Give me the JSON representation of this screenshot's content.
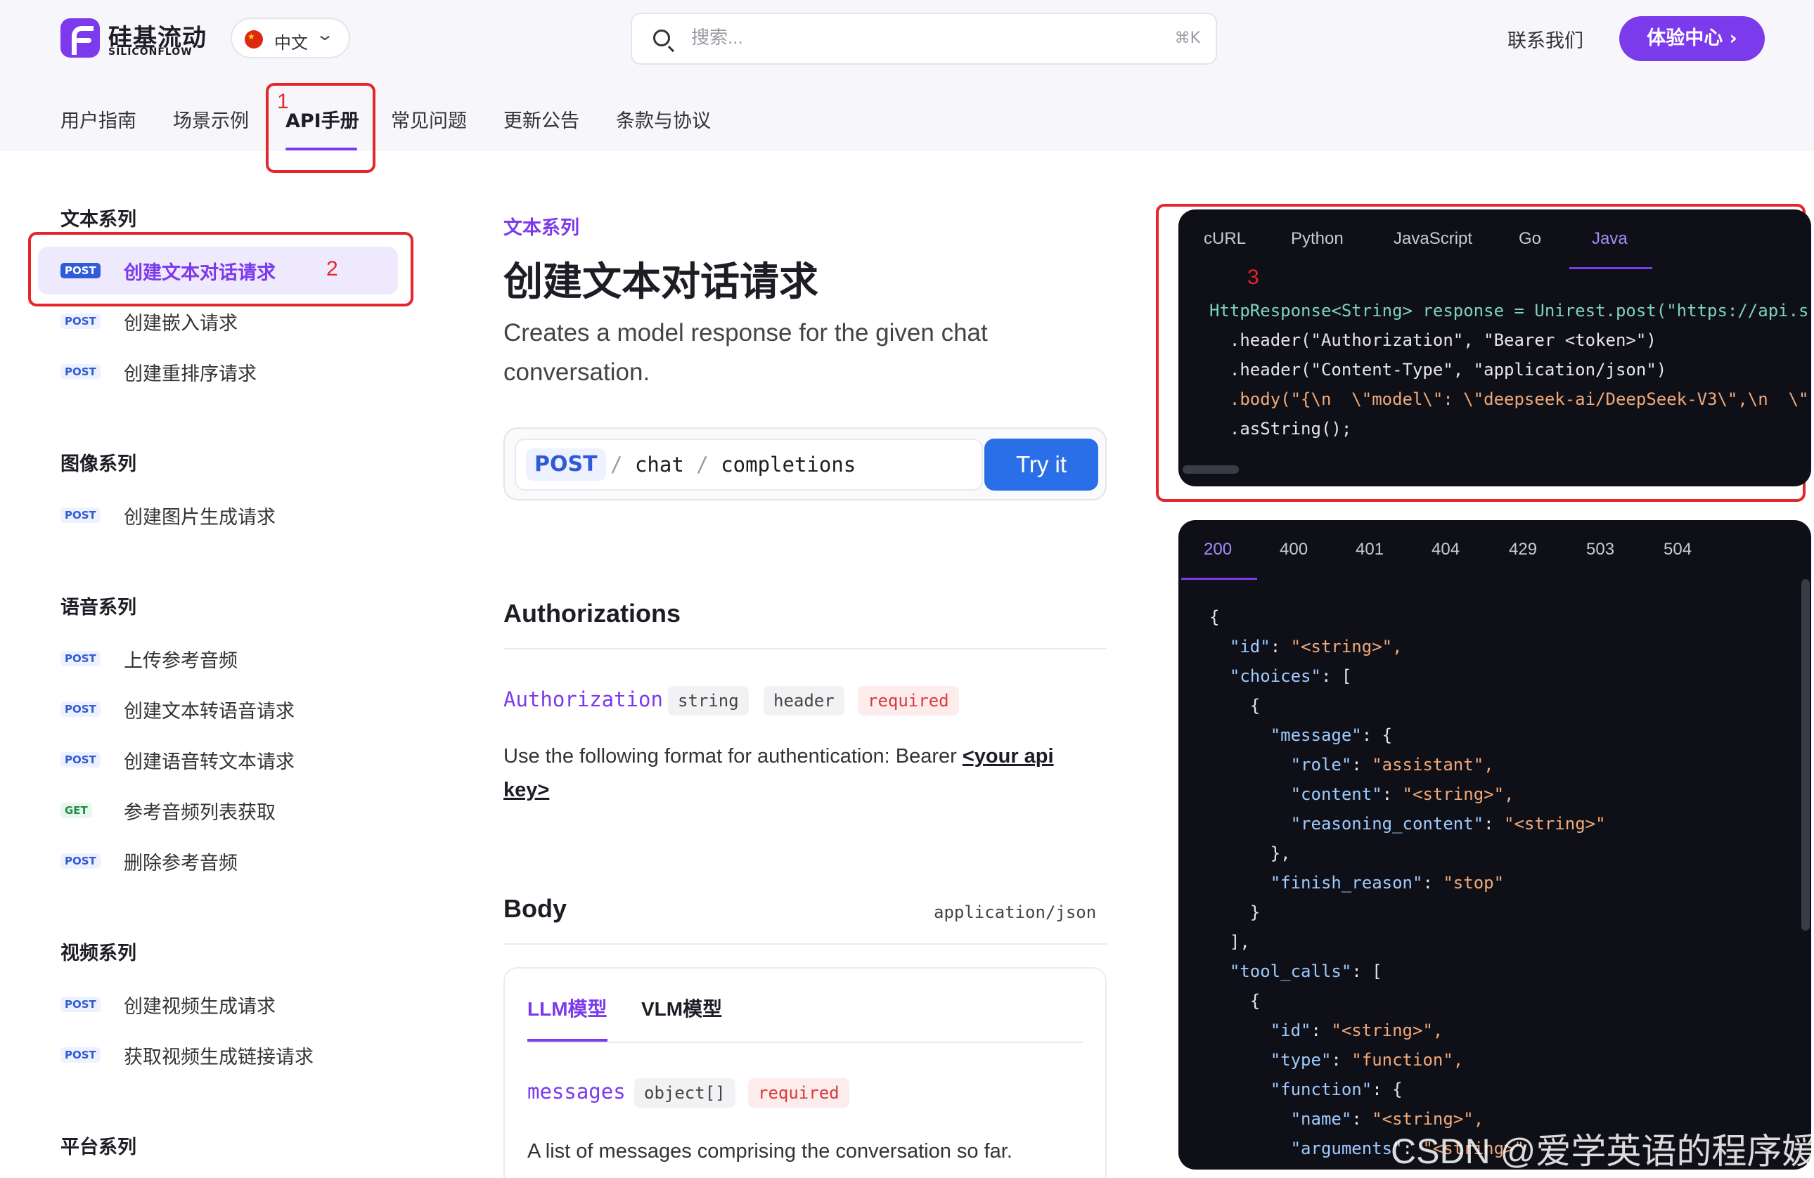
{
  "header": {
    "logo_cn": "硅基流动",
    "logo_en": "SILICONFLOW",
    "lang_label": "中文",
    "search_placeholder": "搜索...",
    "search_shortcut": "⌘K",
    "contact": "联系我们",
    "cta": "体验中心 ›"
  },
  "nav": {
    "items": [
      "用户指南",
      "场景示例",
      "API手册",
      "常见问题",
      "更新公告",
      "条款与协议"
    ],
    "active": "API手册"
  },
  "annotations": [
    "1",
    "2",
    "3"
  ],
  "sidebar": {
    "sections": [
      {
        "title": "文本系列",
        "items": [
          {
            "method": "POST",
            "label": "创建文本对话请求"
          },
          {
            "method": "POST",
            "label": "创建嵌入请求"
          },
          {
            "method": "POST",
            "label": "创建重排序请求"
          }
        ]
      },
      {
        "title": "图像系列",
        "items": [
          {
            "method": "POST",
            "label": "创建图片生成请求"
          }
        ]
      },
      {
        "title": "语音系列",
        "items": [
          {
            "method": "POST",
            "label": "上传参考音频"
          },
          {
            "method": "POST",
            "label": "创建文本转语音请求"
          },
          {
            "method": "POST",
            "label": "创建语音转文本请求"
          },
          {
            "method": "GET",
            "label": "参考音频列表获取"
          },
          {
            "method": "POST",
            "label": "删除参考音频"
          }
        ]
      },
      {
        "title": "视频系列",
        "items": [
          {
            "method": "POST",
            "label": "创建视频生成请求"
          },
          {
            "method": "POST",
            "label": "获取视频生成链接请求"
          }
        ]
      },
      {
        "title": "平台系列",
        "items": []
      }
    ]
  },
  "main": {
    "breadcrumb": "文本系列",
    "title": "创建文本对话请求",
    "description": "Creates a model response for the given chat conversation.",
    "endpoint": {
      "method": "POST",
      "seg1": "chat",
      "seg2": "completions",
      "try_label": "Try it"
    },
    "authorizations": {
      "heading": "Authorizations",
      "param": "Authorization",
      "type": "string",
      "location": "header",
      "required": "required",
      "desc_prefix": "Use the following format for authentication: Bearer ",
      "desc_link": "<your api key>"
    },
    "body": {
      "heading": "Body",
      "content_type": "application/json",
      "tabs": [
        "LLM模型",
        "VLM模型"
      ],
      "param": "messages",
      "type": "object[]",
      "required": "required",
      "desc": "A list of messages comprising the conversation so far."
    }
  },
  "request_code": {
    "tabs": [
      "cURL",
      "Python",
      "JavaScript",
      "Go",
      "Java"
    ],
    "active": "Java",
    "lines": [
      "HttpResponse<String> response = Unirest.post(\"https://api.s",
      "  .header(\"Authorization\", \"Bearer <token>\")",
      "  .header(\"Content-Type\", \"application/json\")",
      "  .body(\"{\\n  \\\"model\\\": \\\"deepseek-ai/DeepSeek-V3\\\",\\n  \\\"",
      "  .asString();"
    ]
  },
  "response_code": {
    "tabs": [
      "200",
      "400",
      "401",
      "404",
      "429",
      "503",
      "504"
    ],
    "active": "200",
    "lines": [
      "{",
      "  \"id\": \"<string>\",",
      "  \"choices\": [",
      "    {",
      "      \"message\": {",
      "        \"role\": \"assistant\",",
      "        \"content\": \"<string>\",",
      "        \"reasoning_content\": \"<string>\"",
      "      },",
      "      \"finish_reason\": \"stop\"",
      "    }",
      "  ],",
      "  \"tool_calls\": [",
      "    {",
      "      \"id\": \"<string>\",",
      "      \"type\": \"function\",",
      "      \"function\": {",
      "        \"name\": \"<string>\",",
      "        \"arguments\": \"<string>\""
    ]
  },
  "watermark": "CSDN @爱学英语的程序媛"
}
